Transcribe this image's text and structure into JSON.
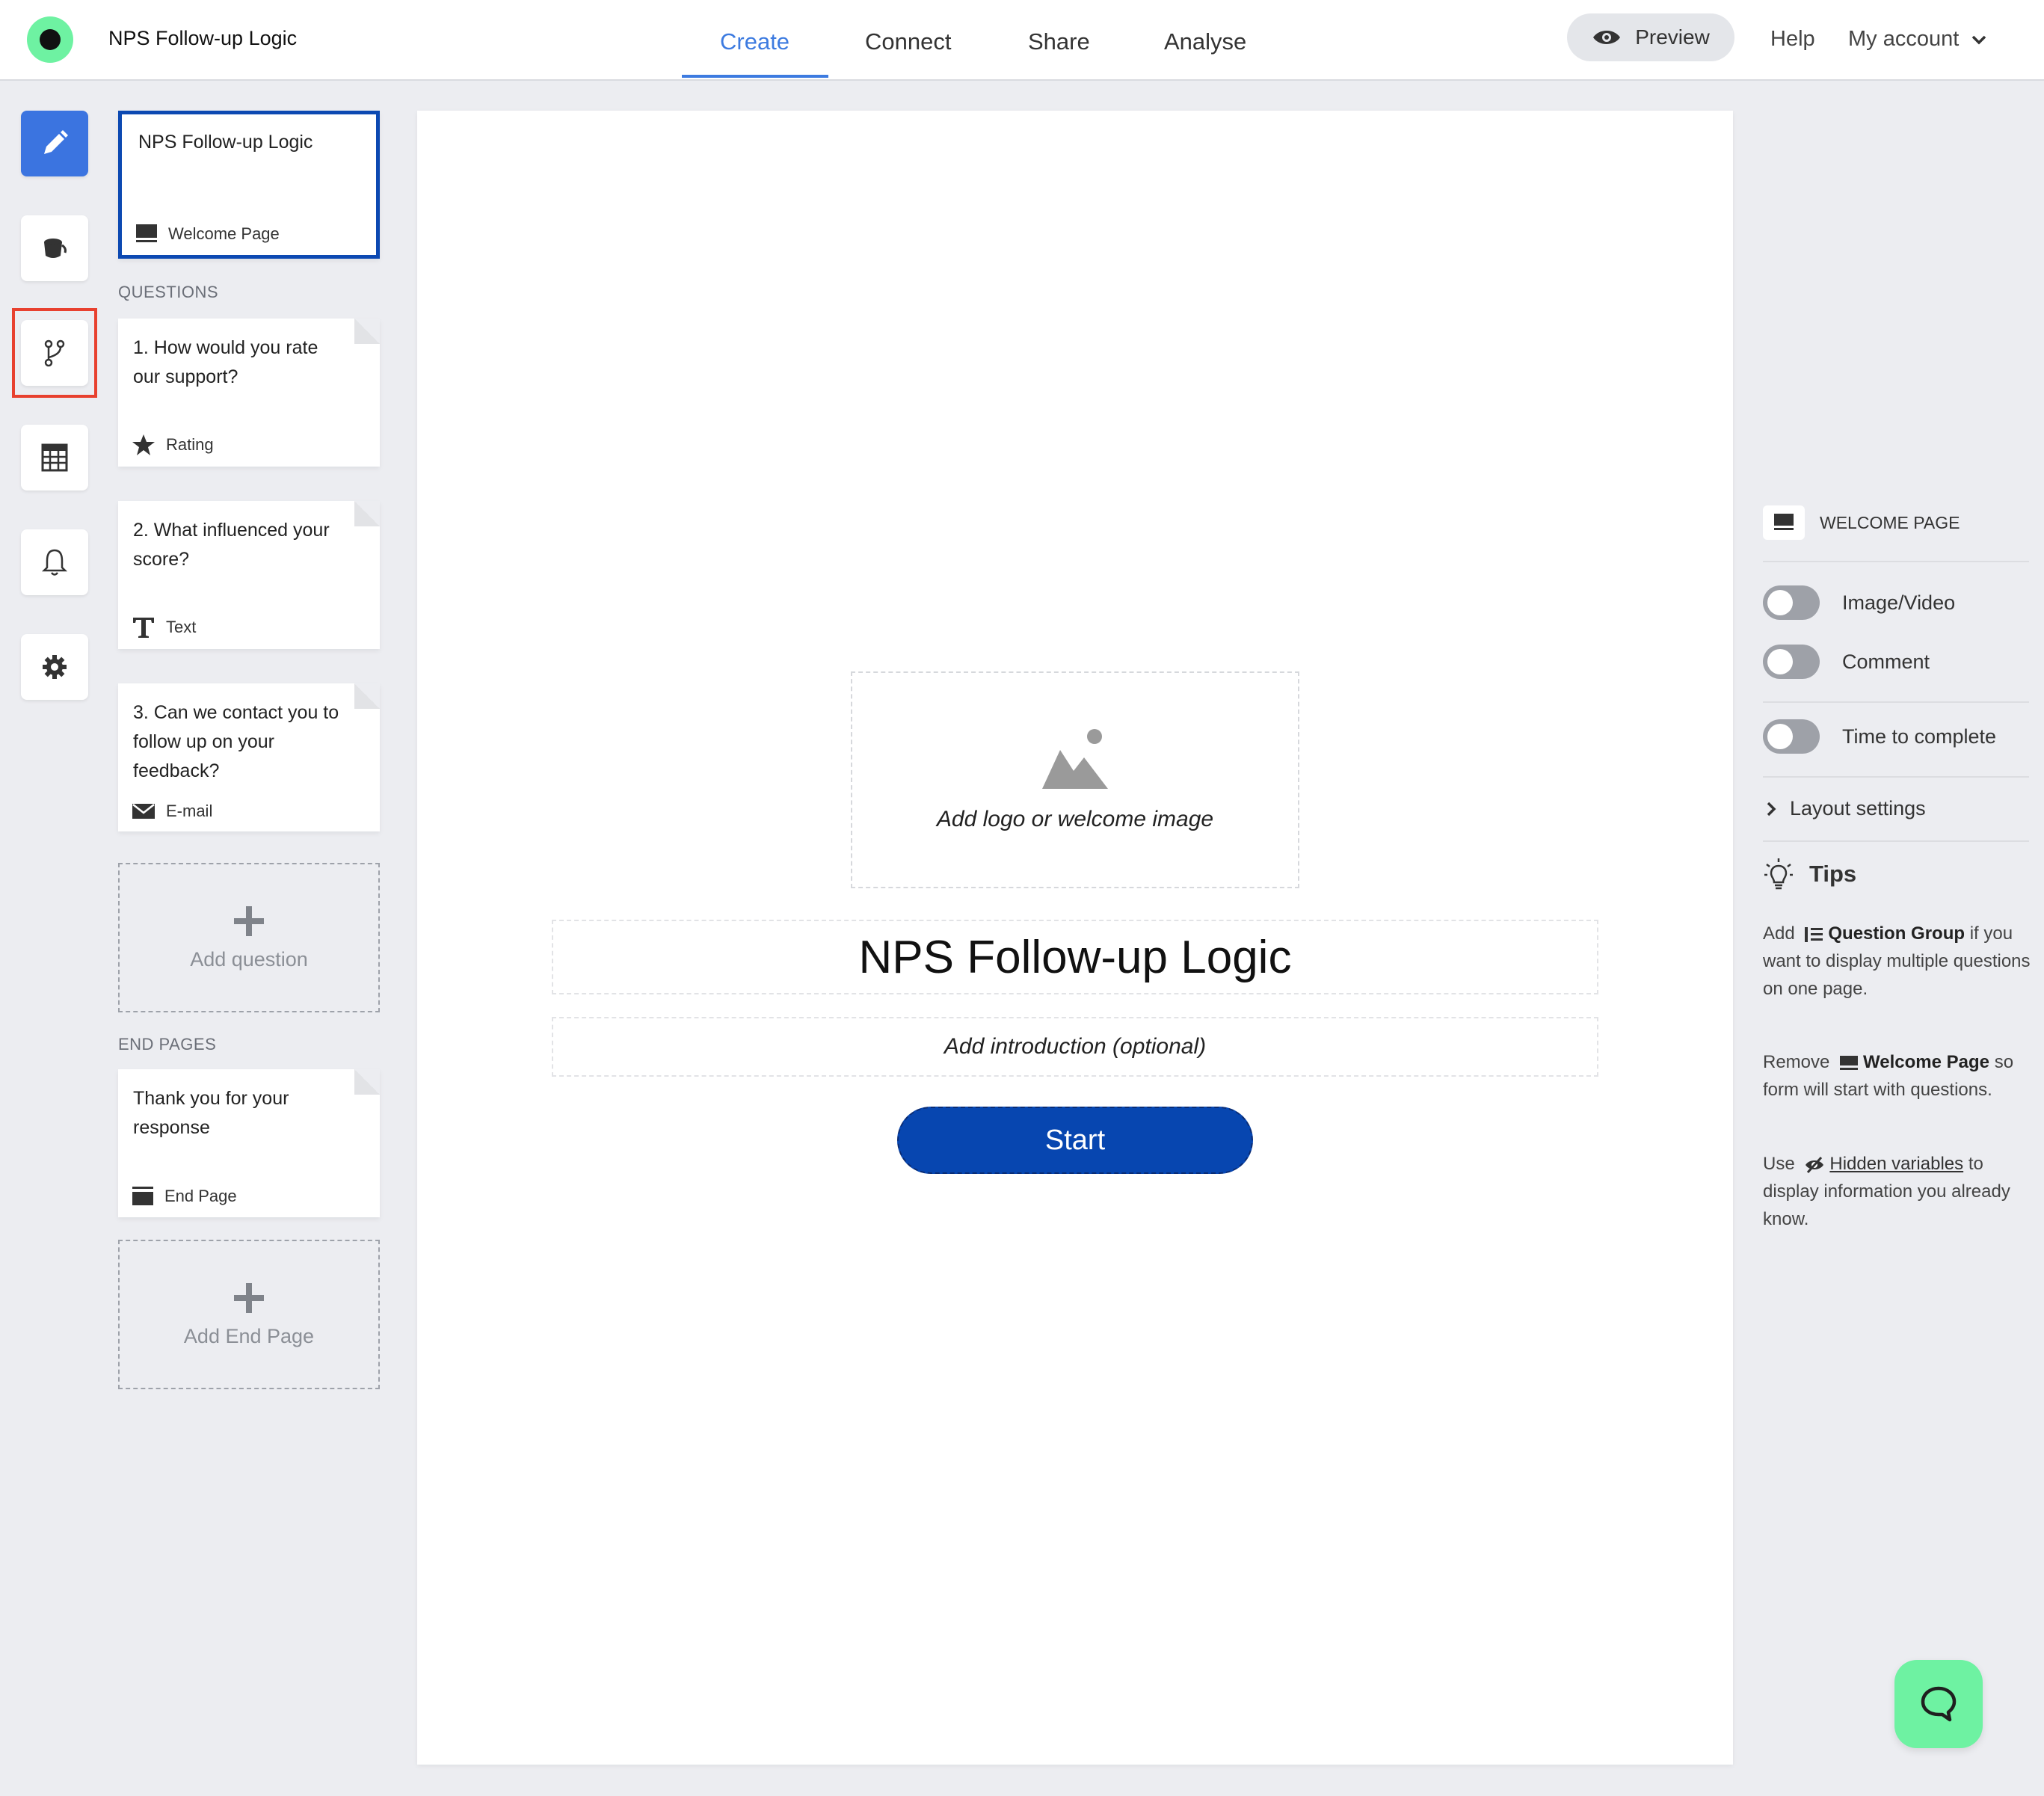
{
  "header": {
    "form_title": "NPS Follow-up Logic",
    "tabs": [
      {
        "label": "Create",
        "active": true
      },
      {
        "label": "Connect",
        "active": false
      },
      {
        "label": "Share",
        "active": false
      },
      {
        "label": "Analyse",
        "active": false
      }
    ],
    "preview_label": "Preview",
    "help_label": "Help",
    "account_label": "My account"
  },
  "rail": {
    "items": [
      {
        "icon": "pencil-icon",
        "active": true
      },
      {
        "icon": "paint-bucket-icon",
        "active": false
      },
      {
        "icon": "branch-logic-icon",
        "active": false,
        "highlighted": true
      },
      {
        "icon": "calculator-icon",
        "active": false
      },
      {
        "icon": "bell-icon",
        "active": false
      },
      {
        "icon": "gear-icon",
        "active": false
      }
    ],
    "highlight_color": "#e8412f"
  },
  "outline": {
    "welcome": {
      "title": "NPS Follow-up Logic",
      "type_label": "Welcome Page"
    },
    "questions_heading": "QUESTIONS",
    "questions": [
      {
        "text": "1. How would you rate our support?",
        "type_label": "Rating",
        "icon": "star-icon"
      },
      {
        "text": "2. What influenced your score?",
        "type_label": "Text",
        "icon": "text-type-icon"
      },
      {
        "text": "3. Can we contact you to follow up on your feedback?",
        "type_label": "E-mail",
        "icon": "envelope-icon"
      }
    ],
    "add_question_label": "Add question",
    "end_pages_heading": "END PAGES",
    "end_pages": [
      {
        "text": "Thank you for your response",
        "type_label": "End Page",
        "icon": "end-page-icon"
      }
    ],
    "add_end_page_label": "Add End Page"
  },
  "canvas": {
    "image_placeholder_label": "Add logo or welcome image",
    "title": "NPS Follow-up Logic",
    "intro_placeholder": "Add introduction (optional)",
    "start_label": "Start"
  },
  "settings": {
    "heading": "WELCOME PAGE",
    "toggles": [
      {
        "label": "Image/Video",
        "on": false
      },
      {
        "label": "Comment",
        "on": false
      },
      {
        "label": "Time to complete",
        "on": false
      }
    ],
    "layout_label": "Layout settings",
    "tips_heading": "Tips",
    "tips": {
      "t1_pre": "Add",
      "t1_bold": "Question Group",
      "t1_post": "if you want to display multiple questions on one page.",
      "t2_pre": "Remove",
      "t2_bold": "Welcome Page",
      "t2_post": "so form will start with questions.",
      "t3_pre": "Use",
      "t3_link": "Hidden variables",
      "t3_post": "to display information you already know."
    }
  },
  "colors": {
    "accent": "#3d7be0",
    "start_button": "#0746b0",
    "brand_green": "#6ef2a2"
  }
}
